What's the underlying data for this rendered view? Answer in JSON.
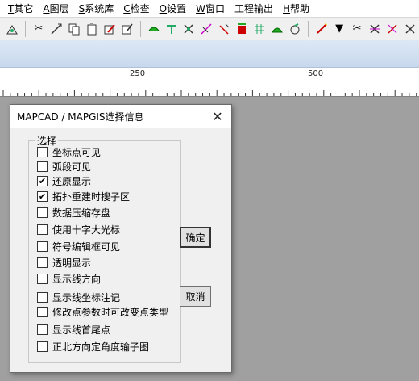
{
  "menu": [
    {
      "acc": "T",
      "rest": "其它"
    },
    {
      "acc": "A",
      "rest": "图层"
    },
    {
      "acc": "S",
      "rest": "系统库"
    },
    {
      "acc": "C",
      "rest": "检查"
    },
    {
      "acc": "O",
      "rest": "设置"
    },
    {
      "acc": "W",
      "rest": "窗口"
    },
    {
      "acc": "",
      "rest": "工程输出"
    },
    {
      "acc": "H",
      "rest": "帮助"
    }
  ],
  "ruler": {
    "mark1": "250",
    "mark2": "500"
  },
  "dialog": {
    "title": "MAPCAD / MAPGIS选择信息",
    "close": "✕",
    "group_label": "选择",
    "options": [
      {
        "label": "坐标点可见",
        "checked": false
      },
      {
        "label": "弧段可见",
        "checked": false
      },
      {
        "label": "还原显示",
        "checked": true
      },
      {
        "label": "拓扑重建时搜子区",
        "checked": true
      },
      {
        "label": "数据压缩存盘",
        "checked": false
      },
      {
        "label": "使用十字大光标",
        "checked": false
      },
      {
        "label": "符号编辑框可见",
        "checked": false
      },
      {
        "label": "透明显示",
        "checked": false
      },
      {
        "label": "显示线方向",
        "checked": false
      },
      {
        "label": "显示线坐标注记",
        "checked": false
      },
      {
        "label": "修改点参数时可改变点类型",
        "checked": false
      },
      {
        "label": "显示线首尾点",
        "checked": false
      },
      {
        "label": "正北方向定角度输子图",
        "checked": false
      }
    ],
    "ok_label": "确定",
    "cancel_label": "取消"
  },
  "colors": {
    "background": "#a0a0a0",
    "dialog": "#f0f0f0",
    "band": "#c8d8ec"
  }
}
